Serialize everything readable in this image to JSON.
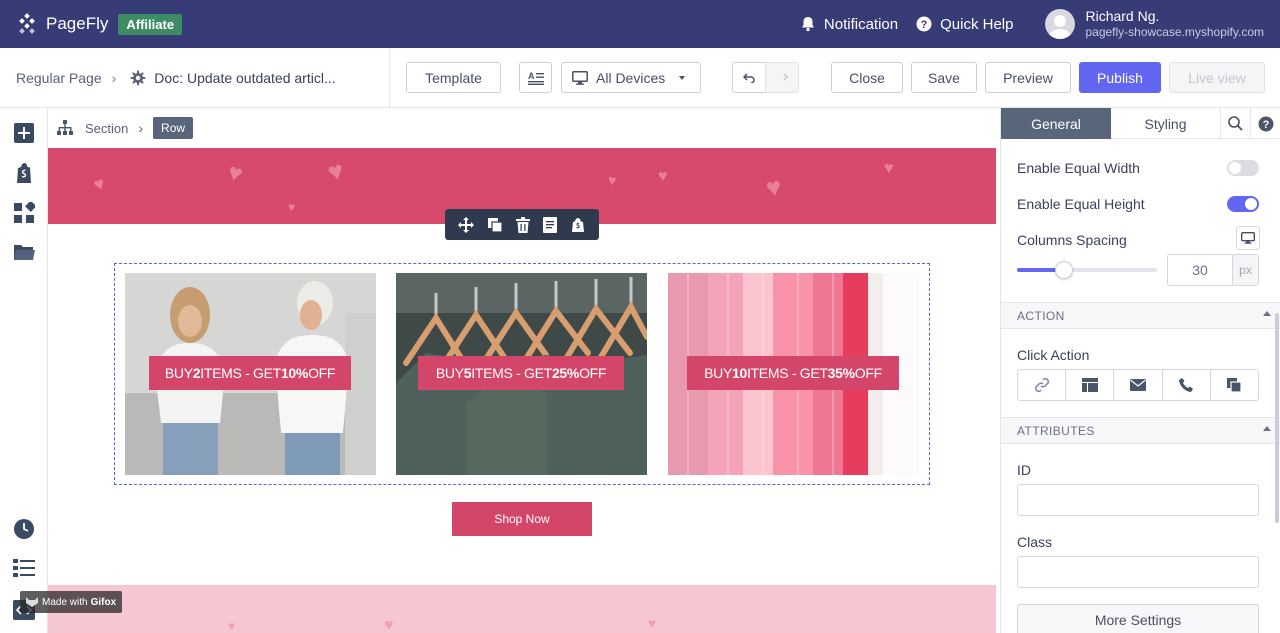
{
  "app": {
    "brand": "PageFly",
    "badge": "Affiliate",
    "notification": "Notification",
    "quick_help": "Quick Help",
    "user_name": "Richard Ng.",
    "user_domain": "pagefly-showcase.myshopify.com"
  },
  "toolbar": {
    "breadcrumb_root": "Regular Page",
    "doc_title": "Doc: Update outdated articl...",
    "template": "Template",
    "devices": "All Devices",
    "close": "Close",
    "save": "Save",
    "preview": "Preview",
    "publish": "Publish",
    "live_view": "Live view"
  },
  "canvas": {
    "crumb_section": "Section",
    "crumb_row": "Row",
    "offers": [
      {
        "pre": "BUY ",
        "num": "2",
        "mid": " ITEMS - GET ",
        "pct": "10%",
        "post": " OFF"
      },
      {
        "pre": "BUY ",
        "num": "5",
        "mid": " ITEMS - GET ",
        "pct": "25%",
        "post": " OFF"
      },
      {
        "pre": "BUY ",
        "num": "10",
        "mid": " ITEMS - GET ",
        "pct": "35%",
        "post": " OFF"
      }
    ],
    "shop_now": "Shop Now",
    "watermark_pre": "Made with",
    "watermark_brand": "Gifox"
  },
  "panel": {
    "tab_general": "General",
    "tab_styling": "Styling",
    "equal_width": "Enable Equal Width",
    "equal_width_on": false,
    "equal_height": "Enable Equal Height",
    "equal_height_on": true,
    "columns_spacing": "Columns Spacing",
    "spacing_value": "30",
    "spacing_unit": "px",
    "action_header": "ACTION",
    "click_action": "Click Action",
    "attributes_header": "ATTRIBUTES",
    "id_label": "ID",
    "class_label": "Class",
    "more_settings": "More Settings"
  },
  "colors": {
    "topbar": "#373b76",
    "accent": "#6366f1",
    "pink": "#d3466a",
    "badge": "#3e8c66"
  }
}
